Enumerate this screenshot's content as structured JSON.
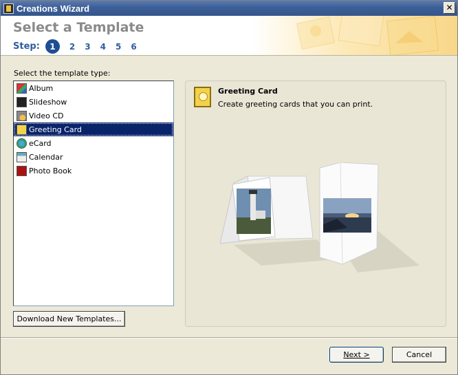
{
  "window": {
    "title": "Creations Wizard",
    "close_label": "✕"
  },
  "header": {
    "title": "Select a Template",
    "step_label": "Step:",
    "steps": [
      "1",
      "2",
      "3",
      "4",
      "5",
      "6"
    ],
    "active_step": 1
  },
  "template_type": {
    "label": "Select the template type:",
    "items": [
      {
        "label": "Album",
        "icon": "album-icon"
      },
      {
        "label": "Slideshow",
        "icon": "slideshow-icon"
      },
      {
        "label": "Video CD",
        "icon": "video-cd-icon"
      },
      {
        "label": "Greeting Card",
        "icon": "greeting-card-icon",
        "selected": true
      },
      {
        "label": "eCard",
        "icon": "ecard-icon"
      },
      {
        "label": "Calendar",
        "icon": "calendar-icon"
      },
      {
        "label": "Photo Book",
        "icon": "photo-book-icon"
      }
    ]
  },
  "preview": {
    "name": "Greeting Card",
    "description": "Create greeting cards that you can print."
  },
  "buttons": {
    "download": "Download New Templates...",
    "next": "Next >",
    "cancel": "Cancel"
  },
  "colors": {
    "selection": "#0a246a",
    "step_active": "#1f4f93",
    "step_text": "#2f5d9f",
    "title_bar": "#3d5f97"
  }
}
